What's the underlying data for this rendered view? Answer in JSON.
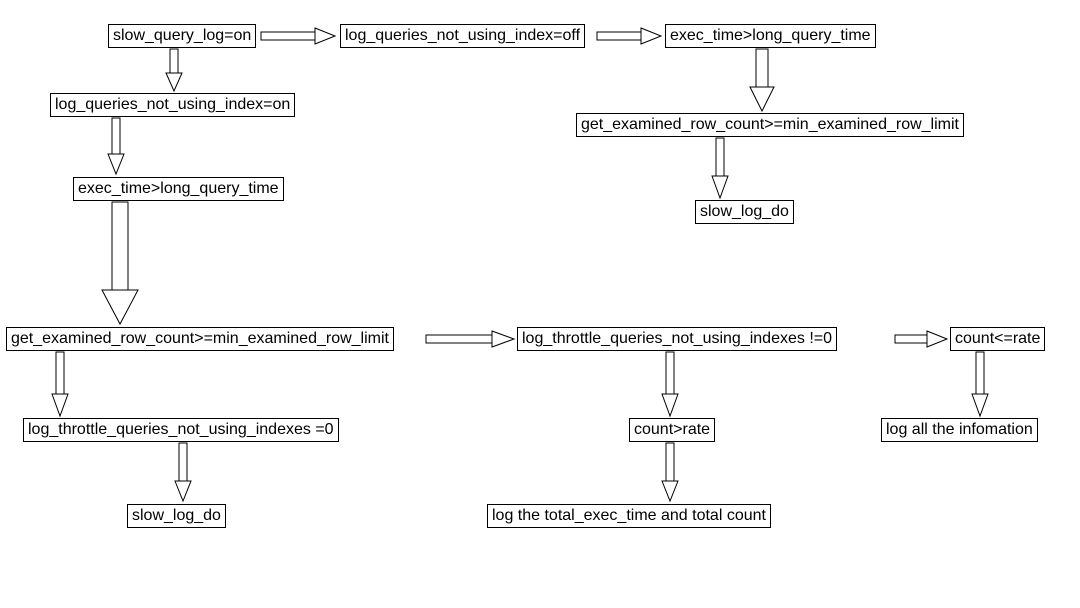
{
  "chart_data": {
    "type": "flowchart",
    "title": "",
    "nodes": [
      {
        "id": "n1",
        "label": "slow_query_log=on"
      },
      {
        "id": "n2",
        "label": "log_queries_not_using_index=off"
      },
      {
        "id": "n3",
        "label": "exec_time>long_query_time"
      },
      {
        "id": "n4",
        "label": "log_queries_not_using_index=on"
      },
      {
        "id": "n5",
        "label": "get_examined_row_count>=min_examined_row_limit"
      },
      {
        "id": "n6",
        "label": "exec_time>long_query_time"
      },
      {
        "id": "n7",
        "label": "slow_log_do"
      },
      {
        "id": "n8",
        "label": "get_examined_row_count>=min_examined_row_limit"
      },
      {
        "id": "n9",
        "label": "log_throttle_queries_not_using_indexes !=0"
      },
      {
        "id": "n10",
        "label": "count<=rate"
      },
      {
        "id": "n11",
        "label": "log_throttle_queries_not_using_indexes  =0"
      },
      {
        "id": "n12",
        "label": "count>rate"
      },
      {
        "id": "n13",
        "label": "log all the infomation"
      },
      {
        "id": "n14",
        "label": "slow_log_do"
      },
      {
        "id": "n15",
        "label": "log the total_exec_time and total count"
      }
    ],
    "edges": [
      {
        "from": "n1",
        "to": "n2"
      },
      {
        "from": "n1",
        "to": "n4"
      },
      {
        "from": "n2",
        "to": "n3"
      },
      {
        "from": "n3",
        "to": "n5"
      },
      {
        "from": "n4",
        "to": "n6"
      },
      {
        "from": "n5",
        "to": "n7"
      },
      {
        "from": "n6",
        "to": "n8"
      },
      {
        "from": "n8",
        "to": "n9"
      },
      {
        "from": "n8",
        "to": "n11"
      },
      {
        "from": "n9",
        "to": "n10"
      },
      {
        "from": "n9",
        "to": "n12"
      },
      {
        "from": "n10",
        "to": "n13"
      },
      {
        "from": "n11",
        "to": "n14"
      },
      {
        "from": "n12",
        "to": "n15"
      }
    ]
  }
}
